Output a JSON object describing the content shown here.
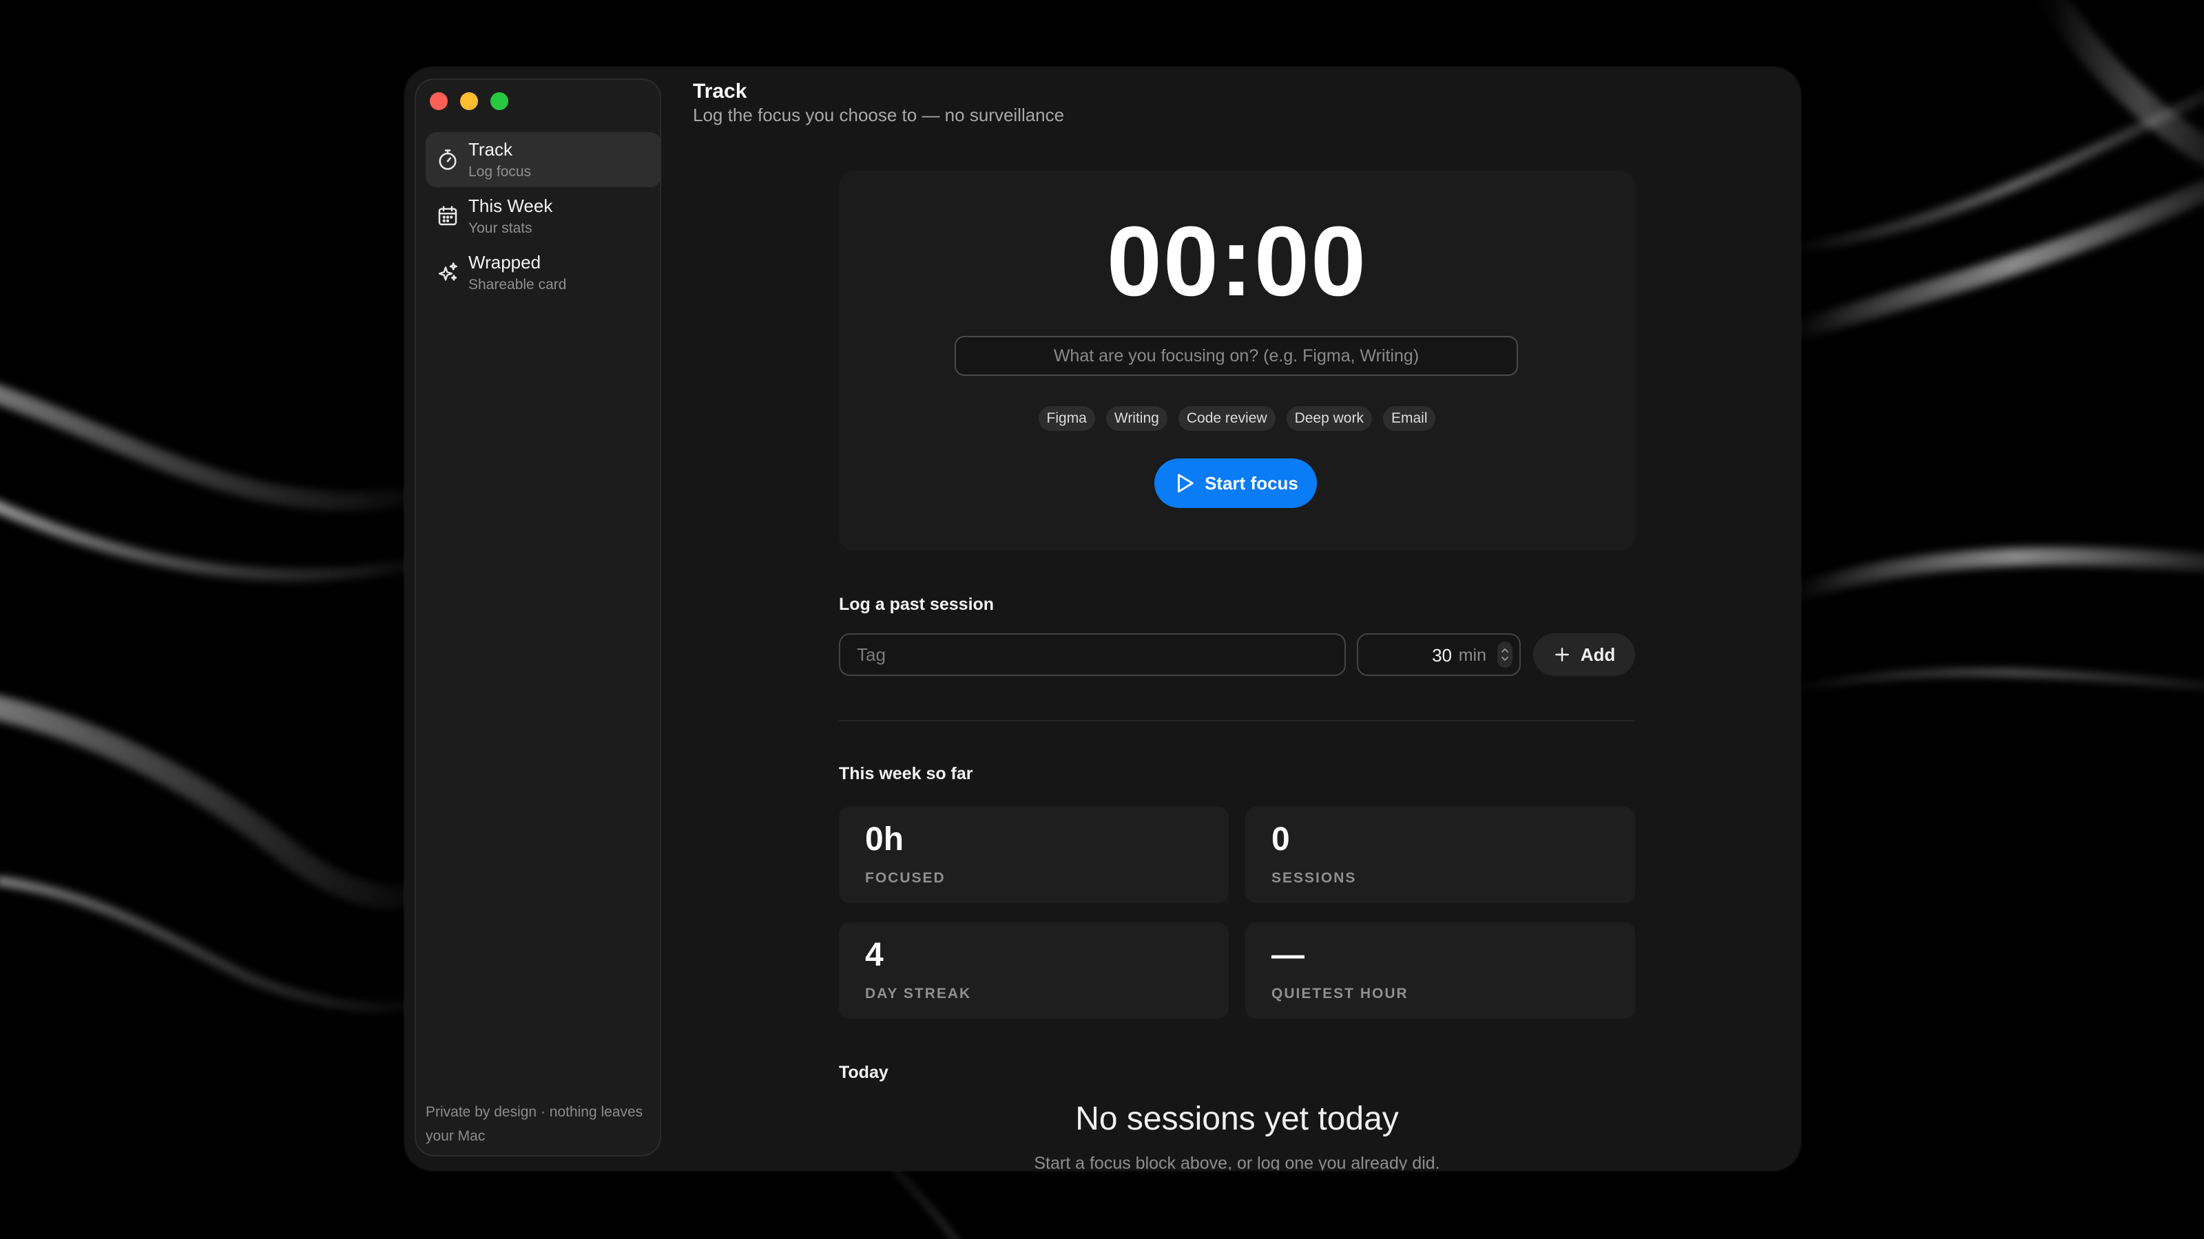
{
  "sidebar": {
    "items": [
      {
        "label": "Track",
        "sub": "Log focus",
        "icon": "stopwatch-icon",
        "active": true
      },
      {
        "label": "This Week",
        "sub": "Your stats",
        "icon": "calendar-icon"
      },
      {
        "label": "Wrapped",
        "sub": "Shareable card",
        "icon": "sparkles-icon"
      }
    ],
    "footer": "Private by design · nothing leaves your Mac"
  },
  "header": {
    "title": "Track",
    "subtitle": "Log the focus you choose to — no surveillance"
  },
  "timer": {
    "display": "00:00",
    "input_placeholder": "What are you focusing on? (e.g. Figma, Writing)",
    "chips": [
      "Figma",
      "Writing",
      "Code review",
      "Deep work",
      "Email"
    ],
    "start_label": "Start focus"
  },
  "log_past": {
    "title": "Log a past session",
    "tag_placeholder": "Tag",
    "minutes_value": "30",
    "minutes_unit": "min",
    "add_label": "Add"
  },
  "week": {
    "title": "This week so far",
    "stats": [
      {
        "value": "0h",
        "label": "FOCUSED"
      },
      {
        "value": "0",
        "label": "SESSIONS"
      },
      {
        "value": "4",
        "label": "DAY STREAK"
      },
      {
        "value": "—",
        "label": "QUIETEST HOUR"
      }
    ]
  },
  "today": {
    "title": "Today",
    "empty_title": "No sessions yet today",
    "empty_sub": "Start a focus block above, or log one you already did."
  },
  "colors": {
    "accent": "#0a7cf5",
    "window_bg": "#161616",
    "sidebar_bg": "#1c1c1c"
  }
}
